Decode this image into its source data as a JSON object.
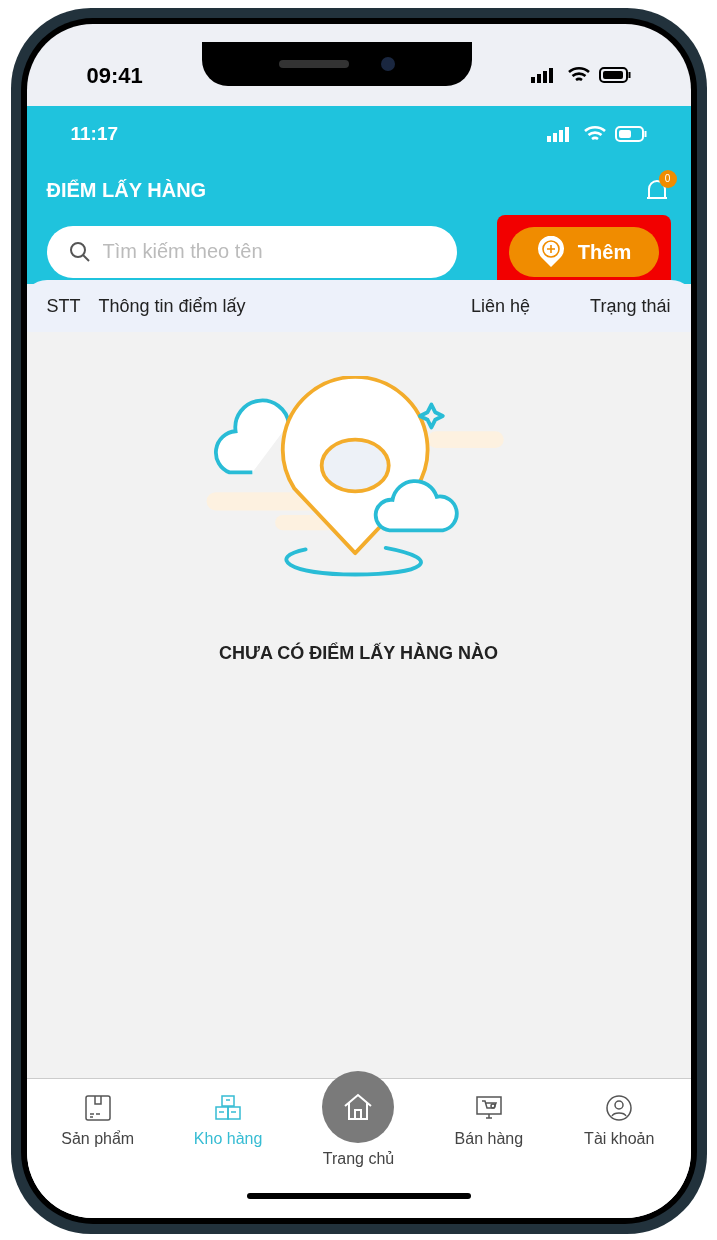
{
  "device_status": {
    "time": "09:41"
  },
  "app_status": {
    "time": "11:17"
  },
  "header": {
    "title": "ĐIỂM LẤY HÀNG",
    "notification_count": "0"
  },
  "search": {
    "placeholder": "Tìm kiếm theo tên"
  },
  "add_button": {
    "label": "Thêm",
    "highlighted": true
  },
  "table": {
    "columns": [
      "STT",
      "Thông tin điểm lấy",
      "Liên hệ",
      "Trạng thái"
    ]
  },
  "empty_state": {
    "message": "CHƯA CÓ ĐIỂM LẤY HÀNG NÀO"
  },
  "bottom_nav": [
    {
      "label": "Sản phẩm",
      "kind": "tab",
      "selected": false
    },
    {
      "label": "Kho hàng",
      "kind": "tab",
      "selected": true
    },
    {
      "label": "Trang chủ",
      "kind": "center",
      "selected": false
    },
    {
      "label": "Bán hàng",
      "kind": "tab",
      "selected": false
    },
    {
      "label": "Tài khoản",
      "kind": "tab",
      "selected": false
    }
  ]
}
